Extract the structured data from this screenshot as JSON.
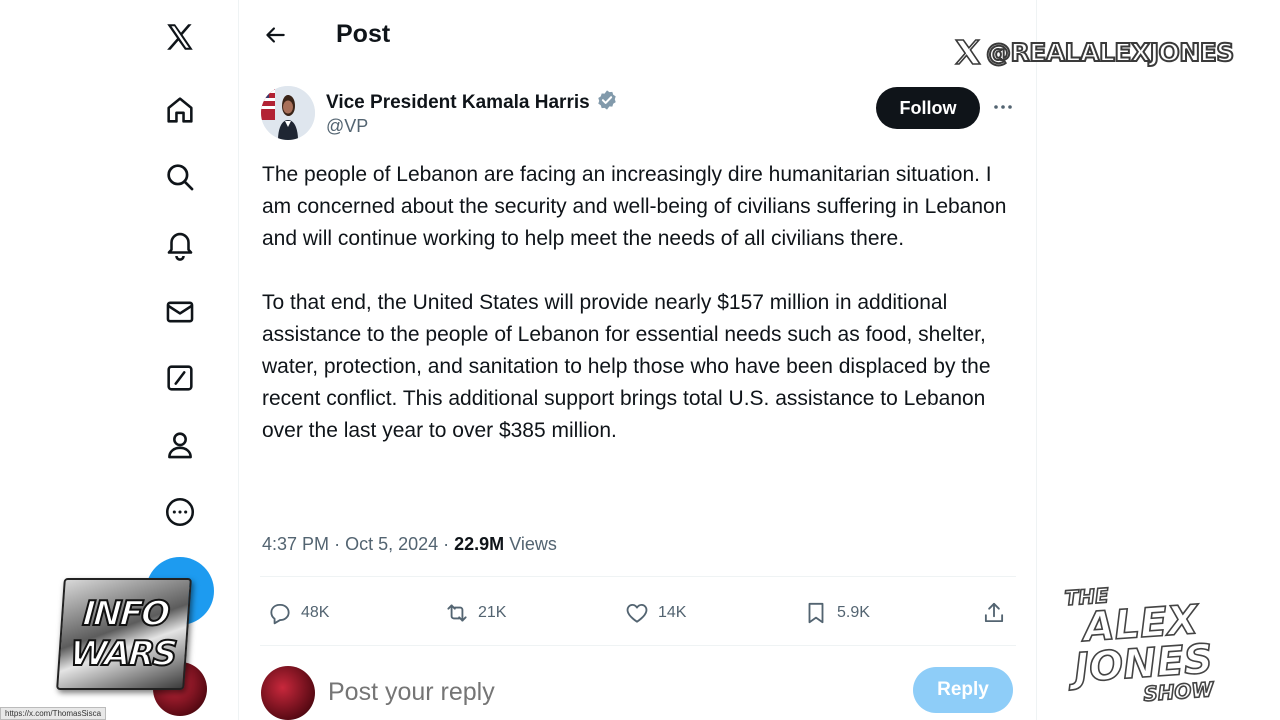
{
  "header": {
    "title": "Post"
  },
  "post": {
    "author_name": "Vice President Kamala Harris",
    "author_handle": "@VP",
    "follow_label": "Follow",
    "paragraphs": [
      "The people of Lebanon are facing an increasingly dire humanitarian situation. I am concerned about the security and well-being of civilians suffering in Lebanon and will continue working to help meet the needs of all civilians there.",
      "To that end, the United States will provide nearly $157 million in additional assistance to the people of Lebanon for essential needs such as food, shelter, water, protection, and sanitation to help those who have been displaced by the recent conflict. This additional support brings total U.S. assistance to Lebanon over the last year to over $385 million."
    ],
    "time": "4:37 PM",
    "date": "Oct 5, 2024",
    "views_count": "22.9M",
    "views_label": "Views"
  },
  "actions": {
    "replies": "48K",
    "reposts": "21K",
    "likes": "14K",
    "bookmarks": "5.9K"
  },
  "reply_box": {
    "placeholder": "Post your reply",
    "button_label": "Reply"
  },
  "sidebar": {
    "items": [
      "x-logo-icon",
      "home-icon",
      "search-icon",
      "notifications-icon",
      "messages-icon",
      "grok-icon",
      "profile-icon",
      "more-icon"
    ]
  },
  "overlay": {
    "watermark_handle": "@REALALEXJONES",
    "logo_left_line1": "INFO",
    "logo_left_line2": "WARS",
    "show_line1": "THE",
    "show_line2": "ALEX",
    "show_line3": "JONES",
    "show_line4": "SHOW",
    "url_text": "https://x.com/ThomasSisca"
  },
  "colors": {
    "accent": "#1d9bf0",
    "text_secondary": "#536471",
    "reply_disabled": "#8ecdf8"
  }
}
